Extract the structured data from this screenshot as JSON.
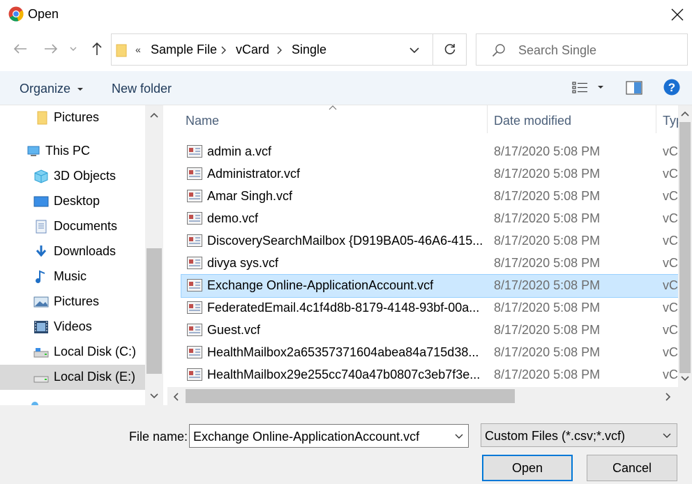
{
  "window": {
    "title": "Open"
  },
  "address": {
    "overflow": "«",
    "crumbs": [
      "Sample File",
      "vCard",
      "Single"
    ]
  },
  "search": {
    "placeholder": "Search Single"
  },
  "toolbar": {
    "organize": "Organize",
    "new_folder": "New folder"
  },
  "sidebar": {
    "items": [
      {
        "label": "Pictures",
        "icon": "folder-icon"
      },
      {
        "label": "This PC",
        "icon": "computer-icon"
      },
      {
        "label": "3D Objects",
        "icon": "cube-icon"
      },
      {
        "label": "Desktop",
        "icon": "desktop-icon"
      },
      {
        "label": "Documents",
        "icon": "document-icon"
      },
      {
        "label": "Downloads",
        "icon": "download-icon"
      },
      {
        "label": "Music",
        "icon": "music-icon"
      },
      {
        "label": "Pictures",
        "icon": "pictures-icon"
      },
      {
        "label": "Videos",
        "icon": "video-icon"
      },
      {
        "label": "Local Disk (C:)",
        "icon": "drive-icon"
      },
      {
        "label": "Local Disk (E:)",
        "icon": "drive-icon"
      }
    ],
    "selected": "Local Disk (E:)"
  },
  "columns": {
    "name": "Name",
    "date": "Date modified",
    "type": "Typ"
  },
  "files": [
    {
      "name": "admin a.vcf",
      "date": "8/17/2020 5:08 PM",
      "type": "vC"
    },
    {
      "name": "Administrator.vcf",
      "date": "8/17/2020 5:08 PM",
      "type": "vC"
    },
    {
      "name": "Amar Singh.vcf",
      "date": "8/17/2020 5:08 PM",
      "type": "vC"
    },
    {
      "name": "demo.vcf",
      "date": "8/17/2020 5:08 PM",
      "type": "vC"
    },
    {
      "name": "DiscoverySearchMailbox {D919BA05-46A6-415...",
      "date": "8/17/2020 5:08 PM",
      "type": "vC"
    },
    {
      "name": "divya sys.vcf",
      "date": "8/17/2020 5:08 PM",
      "type": "vC"
    },
    {
      "name": "Exchange Online-ApplicationAccount.vcf",
      "date": "8/17/2020 5:08 PM",
      "type": "vC"
    },
    {
      "name": "FederatedEmail.4c1f4d8b-8179-4148-93bf-00a...",
      "date": "8/17/2020 5:08 PM",
      "type": "vC"
    },
    {
      "name": "Guest.vcf",
      "date": "8/17/2020 5:08 PM",
      "type": "vC"
    },
    {
      "name": "HealthMailbox2a65357371604abea84a715d38...",
      "date": "8/17/2020 5:08 PM",
      "type": "vC"
    },
    {
      "name": "HealthMailbox29e255cc740a47b0807c3eb7f3e...",
      "date": "8/17/2020 5:08 PM",
      "type": "vC"
    }
  ],
  "selected_file": "Exchange Online-ApplicationAccount.vcf",
  "bottom": {
    "file_name_label": "File name:",
    "file_name_value": "Exchange Online-ApplicationAccount.vcf",
    "filter": "Custom Files (*.csv;*.vcf)",
    "open_label": "Open",
    "cancel_label": "Cancel"
  },
  "colors": {
    "accent": "#0066cc",
    "selection": "#cce8ff",
    "toolbar": "#f0f5fa"
  }
}
